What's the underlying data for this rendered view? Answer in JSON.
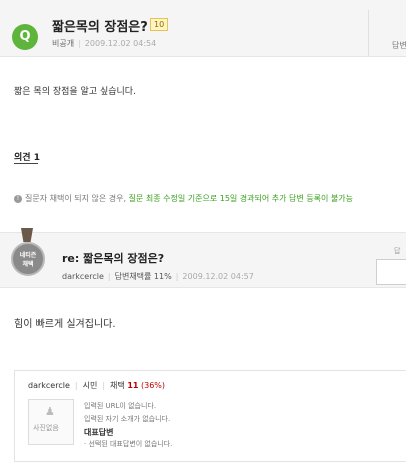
{
  "question": {
    "badge": "Q",
    "title": "짧은목의 장점은?",
    "points": "10",
    "author": "비공개",
    "date": "2009.12.02 04:54",
    "answer_tab": "답변",
    "body": "짧은 목의 장점을 알고 싶습니다."
  },
  "opinion": {
    "label": "의견 1"
  },
  "notice": {
    "icon": "!",
    "text_plain": "질문자 채택이 되지 않은 경우,",
    "text_highlight": "질문 최종 수정일 기준으로 15일 경과되어 추가 답변 등록이 불가능"
  },
  "answer": {
    "medal_line1": "네티즌",
    "medal_line2": "채택",
    "title": "re: 짧은목의 장점은?",
    "author": "darkcercle",
    "adoption_rate": "답변채택률 11%",
    "date": "2009.12.02 04:57",
    "side_label": "답",
    "body": "힘이 빠르게 실겨집니다."
  },
  "profile": {
    "name": "darkcercle",
    "rank": "시민",
    "adopt_label": "채택",
    "adopt_count": "11",
    "adopt_pct": "(36%)",
    "photo_label": "사진없음",
    "url_text": "입력된 URL이 없습니다.",
    "intro_text": "입력된 자기 소개가 없습니다.",
    "rep_title": "대표답변",
    "rep_item": "· 선택된 대표답변이 없습니다."
  },
  "colors": {
    "q_badge": "#5fb53b",
    "highlight_green": "#3aa01e",
    "adopt_red": "#bb0000",
    "medal_gray": "#8a8a8a"
  }
}
